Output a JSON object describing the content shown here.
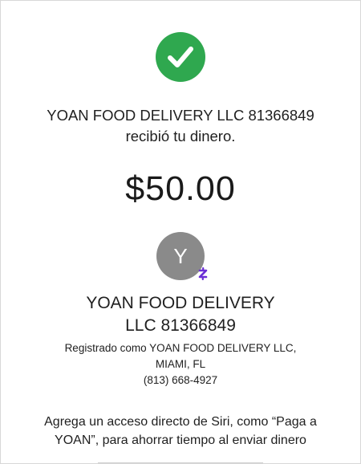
{
  "confirmation": {
    "icon": "checkmark-circle-icon",
    "color": "#2fa84f",
    "recipient_line1": "YOAN FOOD DELIVERY LLC  81366849",
    "recipient_line2": "recibió tu dinero."
  },
  "payment": {
    "amount": "$50.00"
  },
  "recipient": {
    "avatar_initial": "Y",
    "avatar_color": "#8a8a8a",
    "badge_icon": "cash-app-icon",
    "badge_color": "#6b2fd6",
    "name_line1": "YOAN FOOD DELIVERY",
    "name_line2": "LLC  81366849",
    "registered_as": "Registrado como YOAN FOOD DELIVERY LLC,",
    "location": "MIAMI, FL",
    "phone": "(813) 668-4927"
  },
  "siri_prompt": {
    "line1": "Agrega un acceso directo de Siri, como “Paga a",
    "line2": "YOAN”, para ahorrar tiempo al enviar dinero"
  }
}
